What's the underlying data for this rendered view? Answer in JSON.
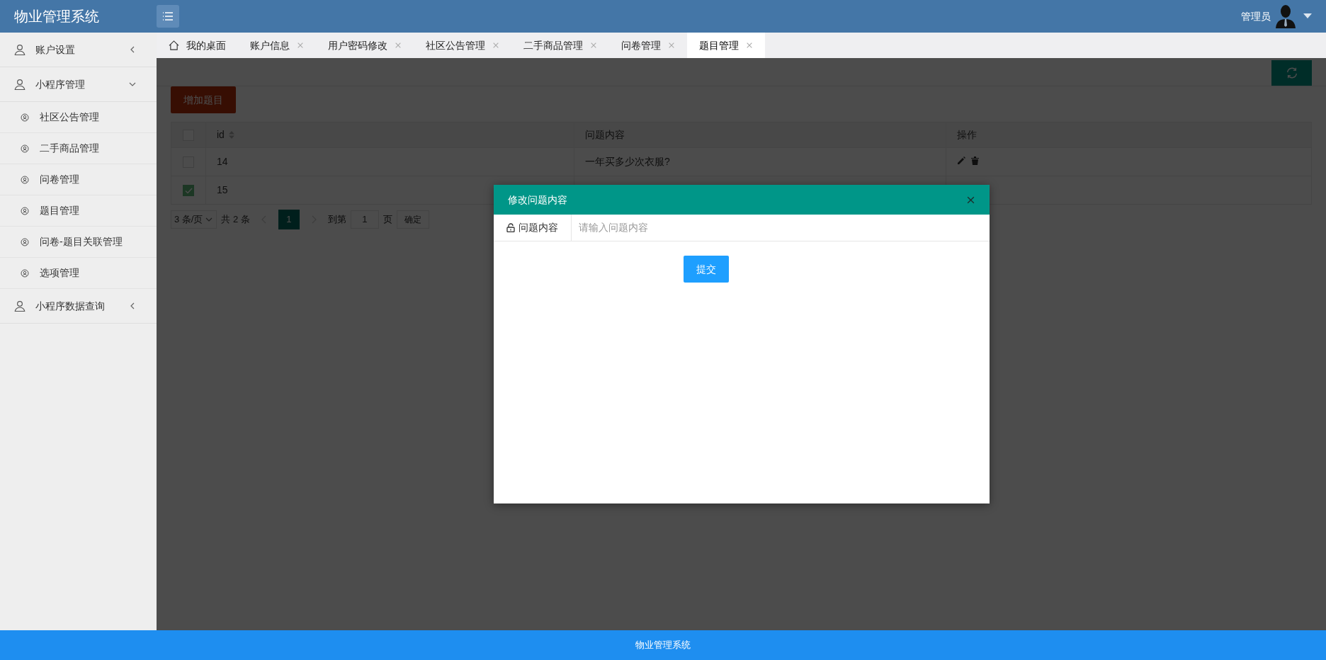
{
  "app_title": "物业管理系统",
  "user": {
    "name": "管理员"
  },
  "sidebar": {
    "items": [
      {
        "label": "账户设置",
        "expanded": false
      },
      {
        "label": "小程序管理",
        "expanded": true,
        "children": [
          {
            "label": "社区公告管理"
          },
          {
            "label": "二手商品管理"
          },
          {
            "label": "问卷管理"
          },
          {
            "label": "题目管理"
          },
          {
            "label": "问卷-题目关联管理"
          },
          {
            "label": "选项管理"
          }
        ]
      },
      {
        "label": "小程序数据查询",
        "expanded": false
      }
    ]
  },
  "tabs": [
    {
      "label": "我的桌面",
      "kind": "home",
      "selected": false
    },
    {
      "label": "账户信息",
      "kind": "page",
      "selected": false
    },
    {
      "label": "用户密码修改",
      "kind": "page",
      "selected": false
    },
    {
      "label": "社区公告管理",
      "kind": "page",
      "selected": false
    },
    {
      "label": "二手商品管理",
      "kind": "page",
      "selected": false
    },
    {
      "label": "问卷管理",
      "kind": "page",
      "selected": false
    },
    {
      "label": "题目管理",
      "kind": "page",
      "selected": true
    }
  ],
  "toolbar": {
    "add_button": "增加题目"
  },
  "table": {
    "header_checked": false,
    "columns": [
      {
        "label": "id",
        "sortable": true
      },
      {
        "label": "问题内容",
        "sortable": false
      },
      {
        "label": "操作",
        "sortable": false
      }
    ],
    "rows": [
      {
        "checked": false,
        "id": "14",
        "content": "一年买多少次衣服?",
        "actions": true
      },
      {
        "checked": true,
        "id": "15"
      }
    ]
  },
  "pagination": {
    "page_size": "3 条/页",
    "total": "共 2 条",
    "pages": [
      {
        "label": "1",
        "selected": true
      }
    ],
    "goto_label": "到第",
    "goto_value": "1",
    "page_unit": "页",
    "confirm": "确定"
  },
  "modal": {
    "title": "修改问题内容",
    "field_label": "问题内容",
    "placeholder": "请输入问题内容",
    "submit": "提交"
  },
  "footer": "物业管理系统"
}
